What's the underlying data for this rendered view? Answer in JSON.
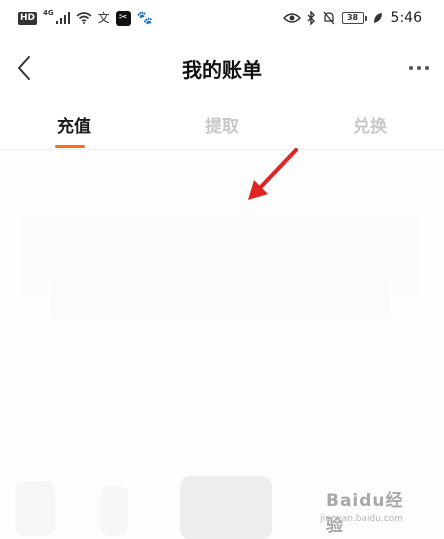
{
  "status_bar": {
    "hd": "HD",
    "net": "4G",
    "signal_icon": "signal-icon",
    "wifi_icon": "wifi-icon",
    "translate_icon_label": "文",
    "capcut_icon": "capcut-app-icon",
    "baidu_icon": "baidu-app-icon",
    "eye_icon": "eye-comfort-icon",
    "bluetooth_icon": "bluetooth-icon",
    "mute_icon": "bell-off-icon",
    "battery_level": "38",
    "leaf_icon": "power-saving-leaf-icon",
    "time": "5:46"
  },
  "nav": {
    "back_icon": "chevron-left-icon",
    "title": "我的账单",
    "more_icon": "more-dots-icon"
  },
  "tabs": [
    {
      "label": "充值",
      "active": true
    },
    {
      "label": "提取",
      "active": false
    },
    {
      "label": "兑换",
      "active": false
    }
  ],
  "annotation": {
    "arrow_color": "#e02424"
  },
  "watermark": {
    "brand": "Baidu经验",
    "url": "jingyan.baidu.com"
  },
  "colors": {
    "accent": "#ff6a1a",
    "tab_inactive": "#c8c8c8",
    "title": "#111111"
  }
}
